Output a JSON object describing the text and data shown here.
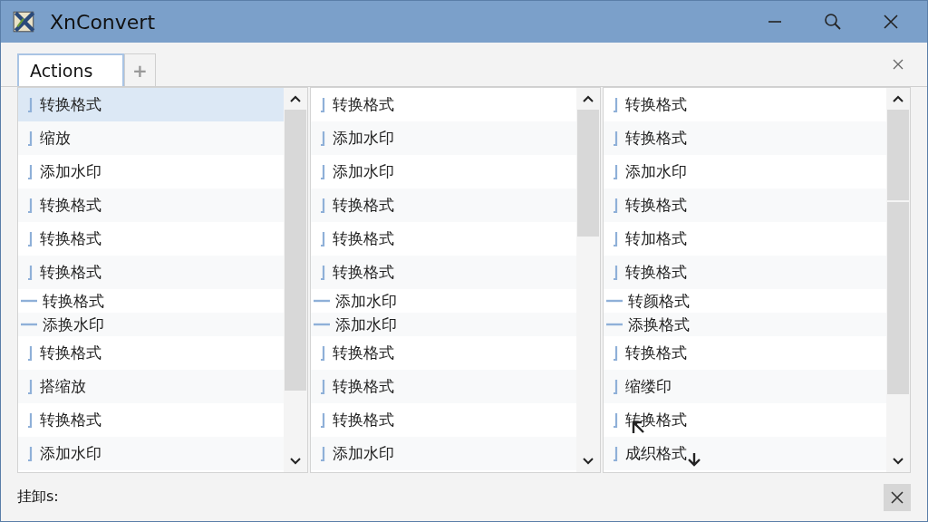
{
  "window": {
    "title": "XnConvert"
  },
  "tabs": [
    {
      "label": "Actions",
      "selected": true
    },
    {
      "label": "+",
      "selected": false
    }
  ],
  "columns": [
    {
      "items": [
        {
          "label": "转换格式",
          "kind": "bar",
          "selected": true
        },
        {
          "label": "缩放",
          "kind": "bar",
          "selected": false
        },
        {
          "label": "添加水印",
          "kind": "bar",
          "selected": false
        },
        {
          "label": "转换格式",
          "kind": "bar",
          "selected": false
        },
        {
          "label": "转换格式",
          "kind": "bar",
          "selected": false
        },
        {
          "label": "转换格式",
          "kind": "bar",
          "selected": false
        },
        {
          "label": "转换格式",
          "kind": "dash",
          "selected": false
        },
        {
          "label": "添换水印",
          "kind": "dash",
          "selected": false
        },
        {
          "label": "转换格式",
          "kind": "bar",
          "selected": false
        },
        {
          "label": "搭缩放",
          "kind": "bar",
          "selected": false
        },
        {
          "label": "转换格式",
          "kind": "bar",
          "selected": false
        },
        {
          "label": "添加水印",
          "kind": "bar",
          "selected": false
        }
      ]
    },
    {
      "items": [
        {
          "label": "转换格式",
          "kind": "bar",
          "selected": false
        },
        {
          "label": "添加水印",
          "kind": "bar",
          "selected": false
        },
        {
          "label": "添加水印",
          "kind": "bar",
          "selected": false
        },
        {
          "label": "转换格式",
          "kind": "bar",
          "selected": false
        },
        {
          "label": "转换格式",
          "kind": "bar",
          "selected": false
        },
        {
          "label": "转换格式",
          "kind": "bar",
          "selected": false
        },
        {
          "label": "添加水印",
          "kind": "dash",
          "selected": false
        },
        {
          "label": "添加水印",
          "kind": "dash",
          "selected": false
        },
        {
          "label": "转换格式",
          "kind": "bar",
          "selected": false
        },
        {
          "label": "转换格式",
          "kind": "bar",
          "selected": false
        },
        {
          "label": "转换格式",
          "kind": "bar",
          "selected": false
        },
        {
          "label": "添加水印",
          "kind": "bar",
          "selected": false
        }
      ]
    },
    {
      "items": [
        {
          "label": "转换格式",
          "kind": "bar",
          "selected": false
        },
        {
          "label": "转换格式",
          "kind": "bar",
          "selected": false
        },
        {
          "label": "添加水印",
          "kind": "bar",
          "selected": false
        },
        {
          "label": "转换格式",
          "kind": "bar",
          "selected": false
        },
        {
          "label": "转加格式",
          "kind": "bar",
          "selected": false
        },
        {
          "label": "转换格式",
          "kind": "bar",
          "selected": false
        },
        {
          "label": "转颜格式",
          "kind": "dash",
          "selected": false
        },
        {
          "label": "添换格式",
          "kind": "dash",
          "selected": false
        },
        {
          "label": "转换格式",
          "kind": "bar",
          "selected": false
        },
        {
          "label": "缩缕印",
          "kind": "bar",
          "selected": false
        },
        {
          "label": "转换格式",
          "kind": "bar",
          "selected": false
        },
        {
          "label": "成织格式",
          "kind": "bar",
          "selected": false
        }
      ]
    }
  ],
  "status_bar": {
    "label": "挂卸s:"
  }
}
